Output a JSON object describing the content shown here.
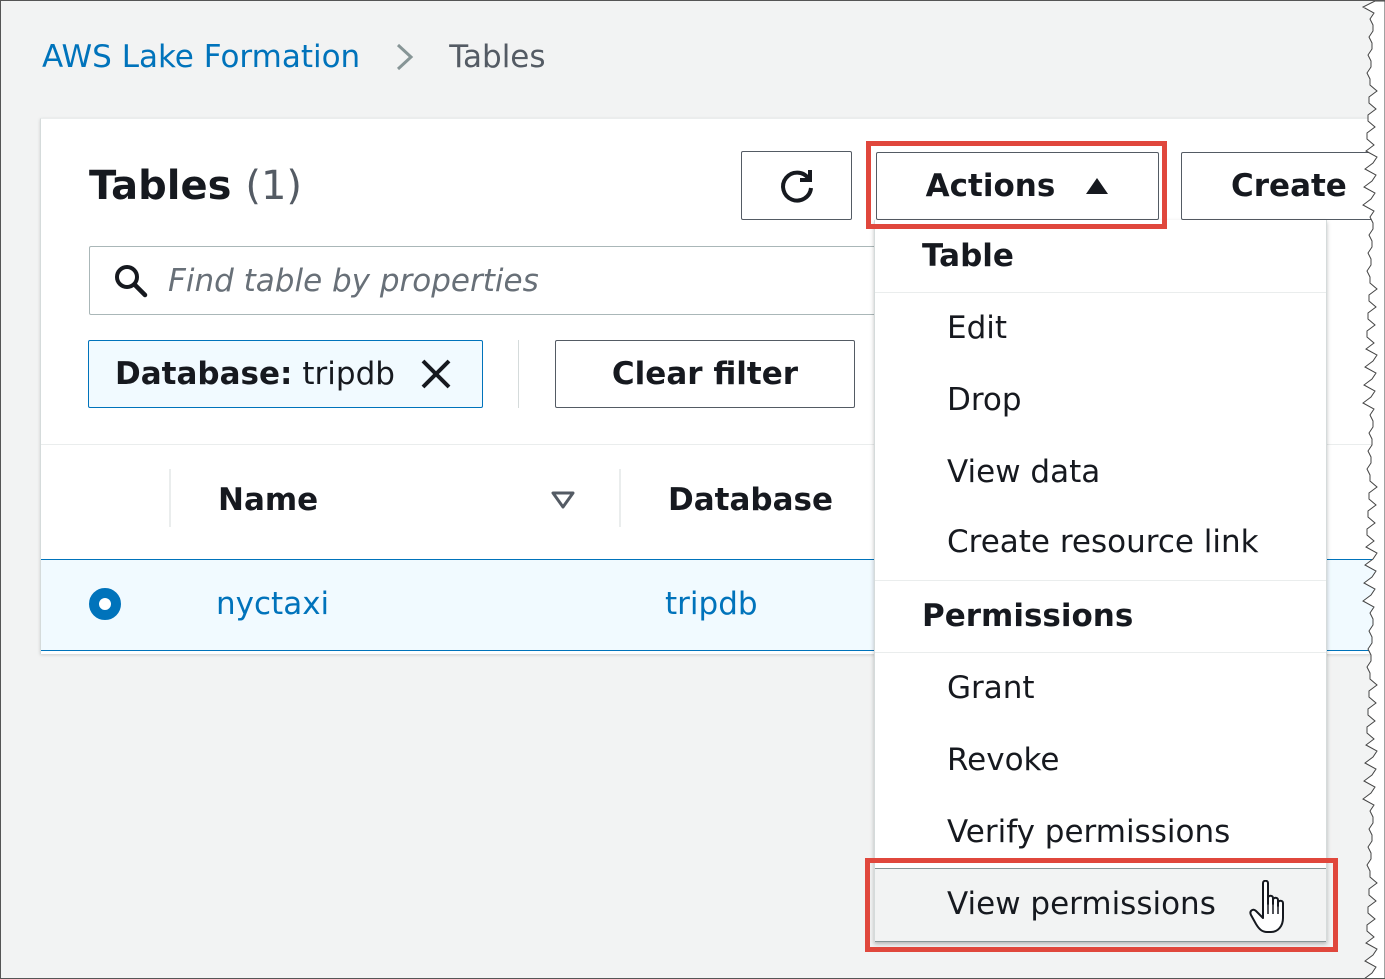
{
  "breadcrumb": {
    "root": "AWS Lake Formation",
    "current": "Tables"
  },
  "header": {
    "title": "Tables",
    "count": "(1)",
    "actions_label": "Actions",
    "create_label": "Create"
  },
  "search": {
    "placeholder": "Find table by properties"
  },
  "filter": {
    "token_key": "Database:",
    "token_value": "tripdb",
    "clear_label": "Clear filter"
  },
  "table": {
    "columns": [
      "Name",
      "Database"
    ],
    "rows": [
      {
        "name": "nyctaxi",
        "database": "tripdb",
        "selected": true
      }
    ]
  },
  "actions_menu": {
    "groups": [
      {
        "label": "Table",
        "items": [
          "Edit",
          "Drop",
          "View data",
          "Create resource link"
        ]
      },
      {
        "label": "Permissions",
        "items": [
          "Grant",
          "Revoke",
          "Verify permissions",
          "View permissions"
        ]
      }
    ],
    "hovered_item": "View permissions"
  },
  "icons": {
    "breadcrumb_separator": "chevron-right-icon",
    "refresh": "refresh-icon",
    "actions_caret": "caret-up-icon",
    "search": "search-icon",
    "dismiss": "close-icon",
    "sort": "sort-down-icon",
    "cursor": "hand-pointer-icon"
  },
  "colors": {
    "link": "#0073bb",
    "highlight": "#e0473c",
    "selected_row_bg": "#f1faff",
    "page_bg": "#f2f3f3"
  }
}
